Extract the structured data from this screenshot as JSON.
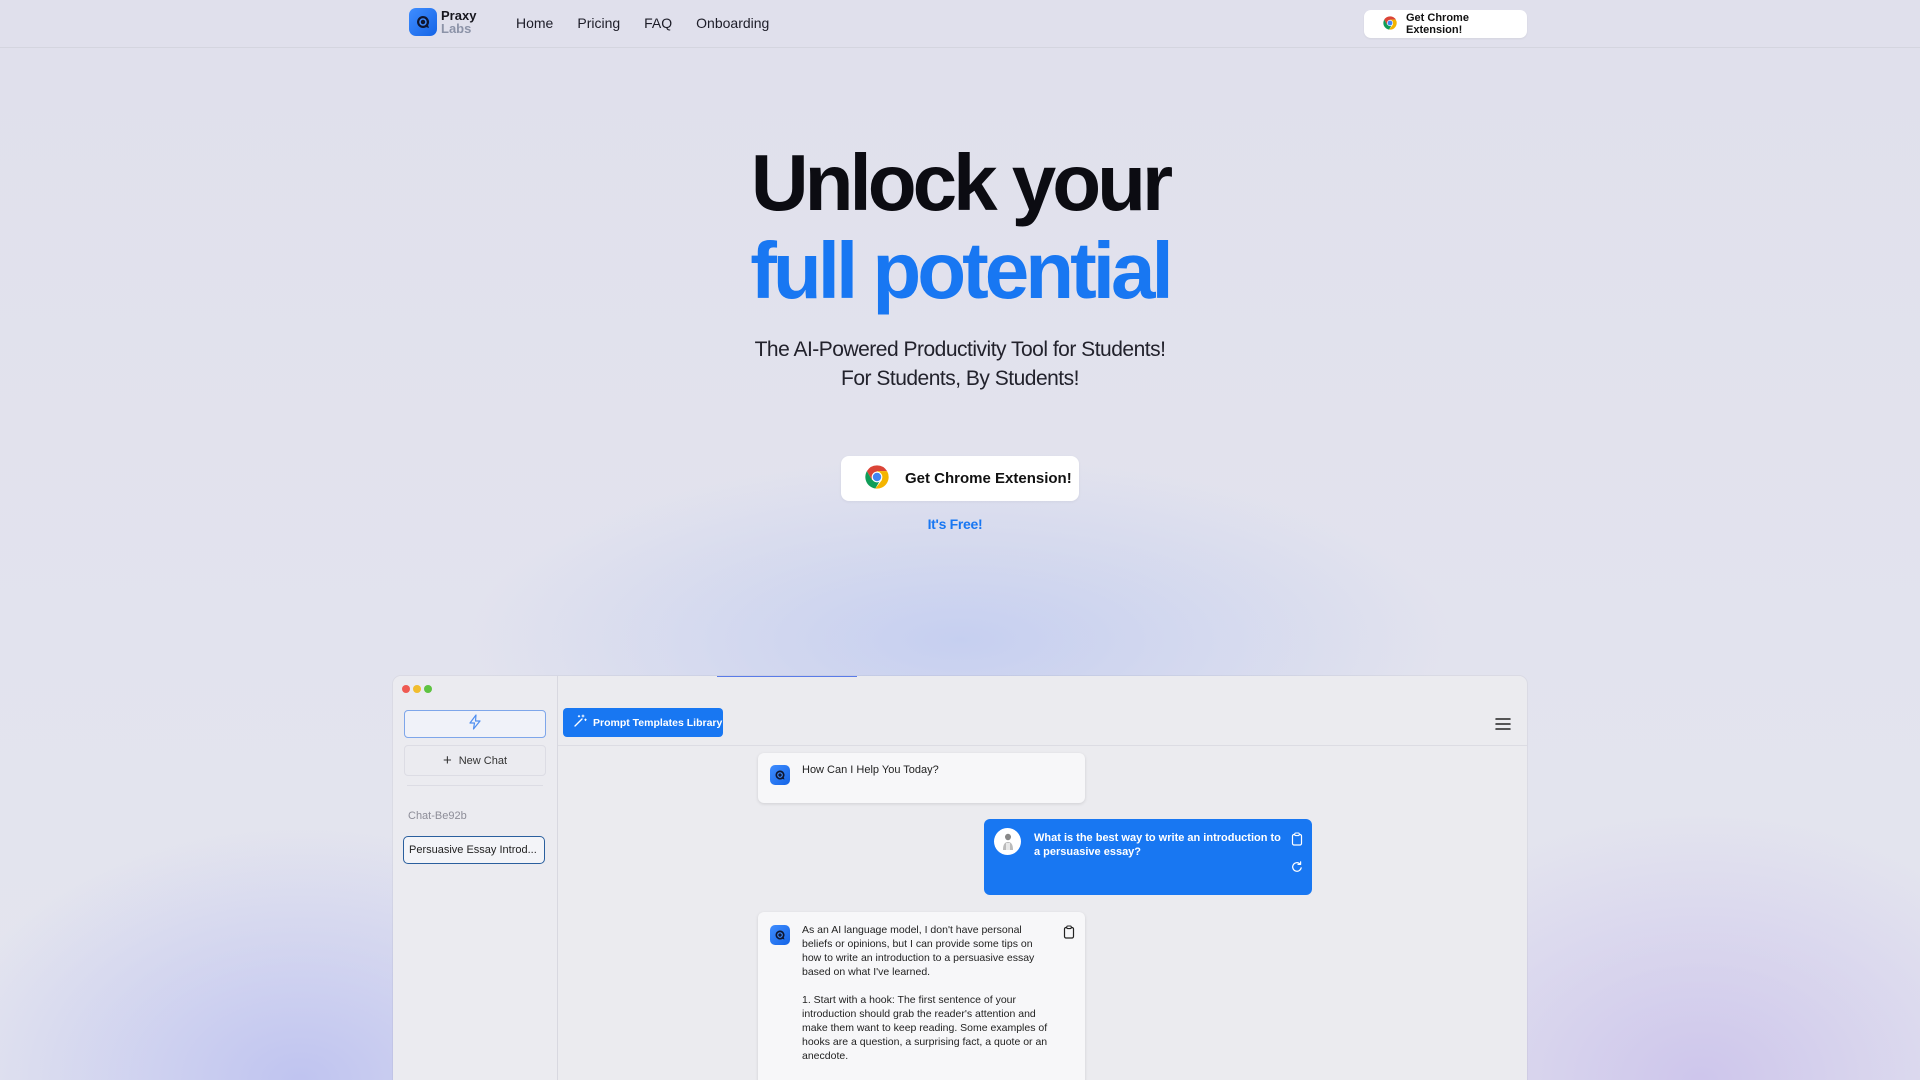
{
  "brand": {
    "name_line1": "Praxy",
    "name_line2": "Labs"
  },
  "nav": {
    "links": [
      "Home",
      "Pricing",
      "FAQ",
      "Onboarding"
    ],
    "cta_label": "Get Chrome Extension!"
  },
  "hero": {
    "title_line1": "Unlock your",
    "title_line2": "full potential",
    "subtitle_line1": "The AI-Powered Productivity Tool for Students!",
    "subtitle_line2": "For Students, By Students!",
    "cta_label": "Get Chrome Extension!",
    "cta_note": "It's Free!"
  },
  "colors": {
    "accent": "#1877f2",
    "dot_red": "#ef5a52",
    "dot_yellow": "#f1bd2e",
    "dot_green": "#5ec341"
  },
  "app": {
    "sidebar": {
      "new_chat_label": "New Chat",
      "chat_id": "Chat-Be92b",
      "history": [
        "Persuasive Essay Introd..."
      ]
    },
    "header": {
      "templates_button_label": "Prompt Templates Library"
    },
    "messages": {
      "greeting": "How Can I Help You Today?",
      "user_question": "What is the best way to write an introduction to a persuasive essay?",
      "answer_p1": "As an AI language model, I don't have personal beliefs or opinions, but I can provide some tips on how to write an introduction to a persuasive essay based on what I've learned.",
      "answer_p2": "1. Start with a hook: The first sentence of your introduction should grab the reader's attention and make them want to keep reading. Some examples of hooks are a question, a surprising fact, a quote or an anecdote."
    }
  }
}
